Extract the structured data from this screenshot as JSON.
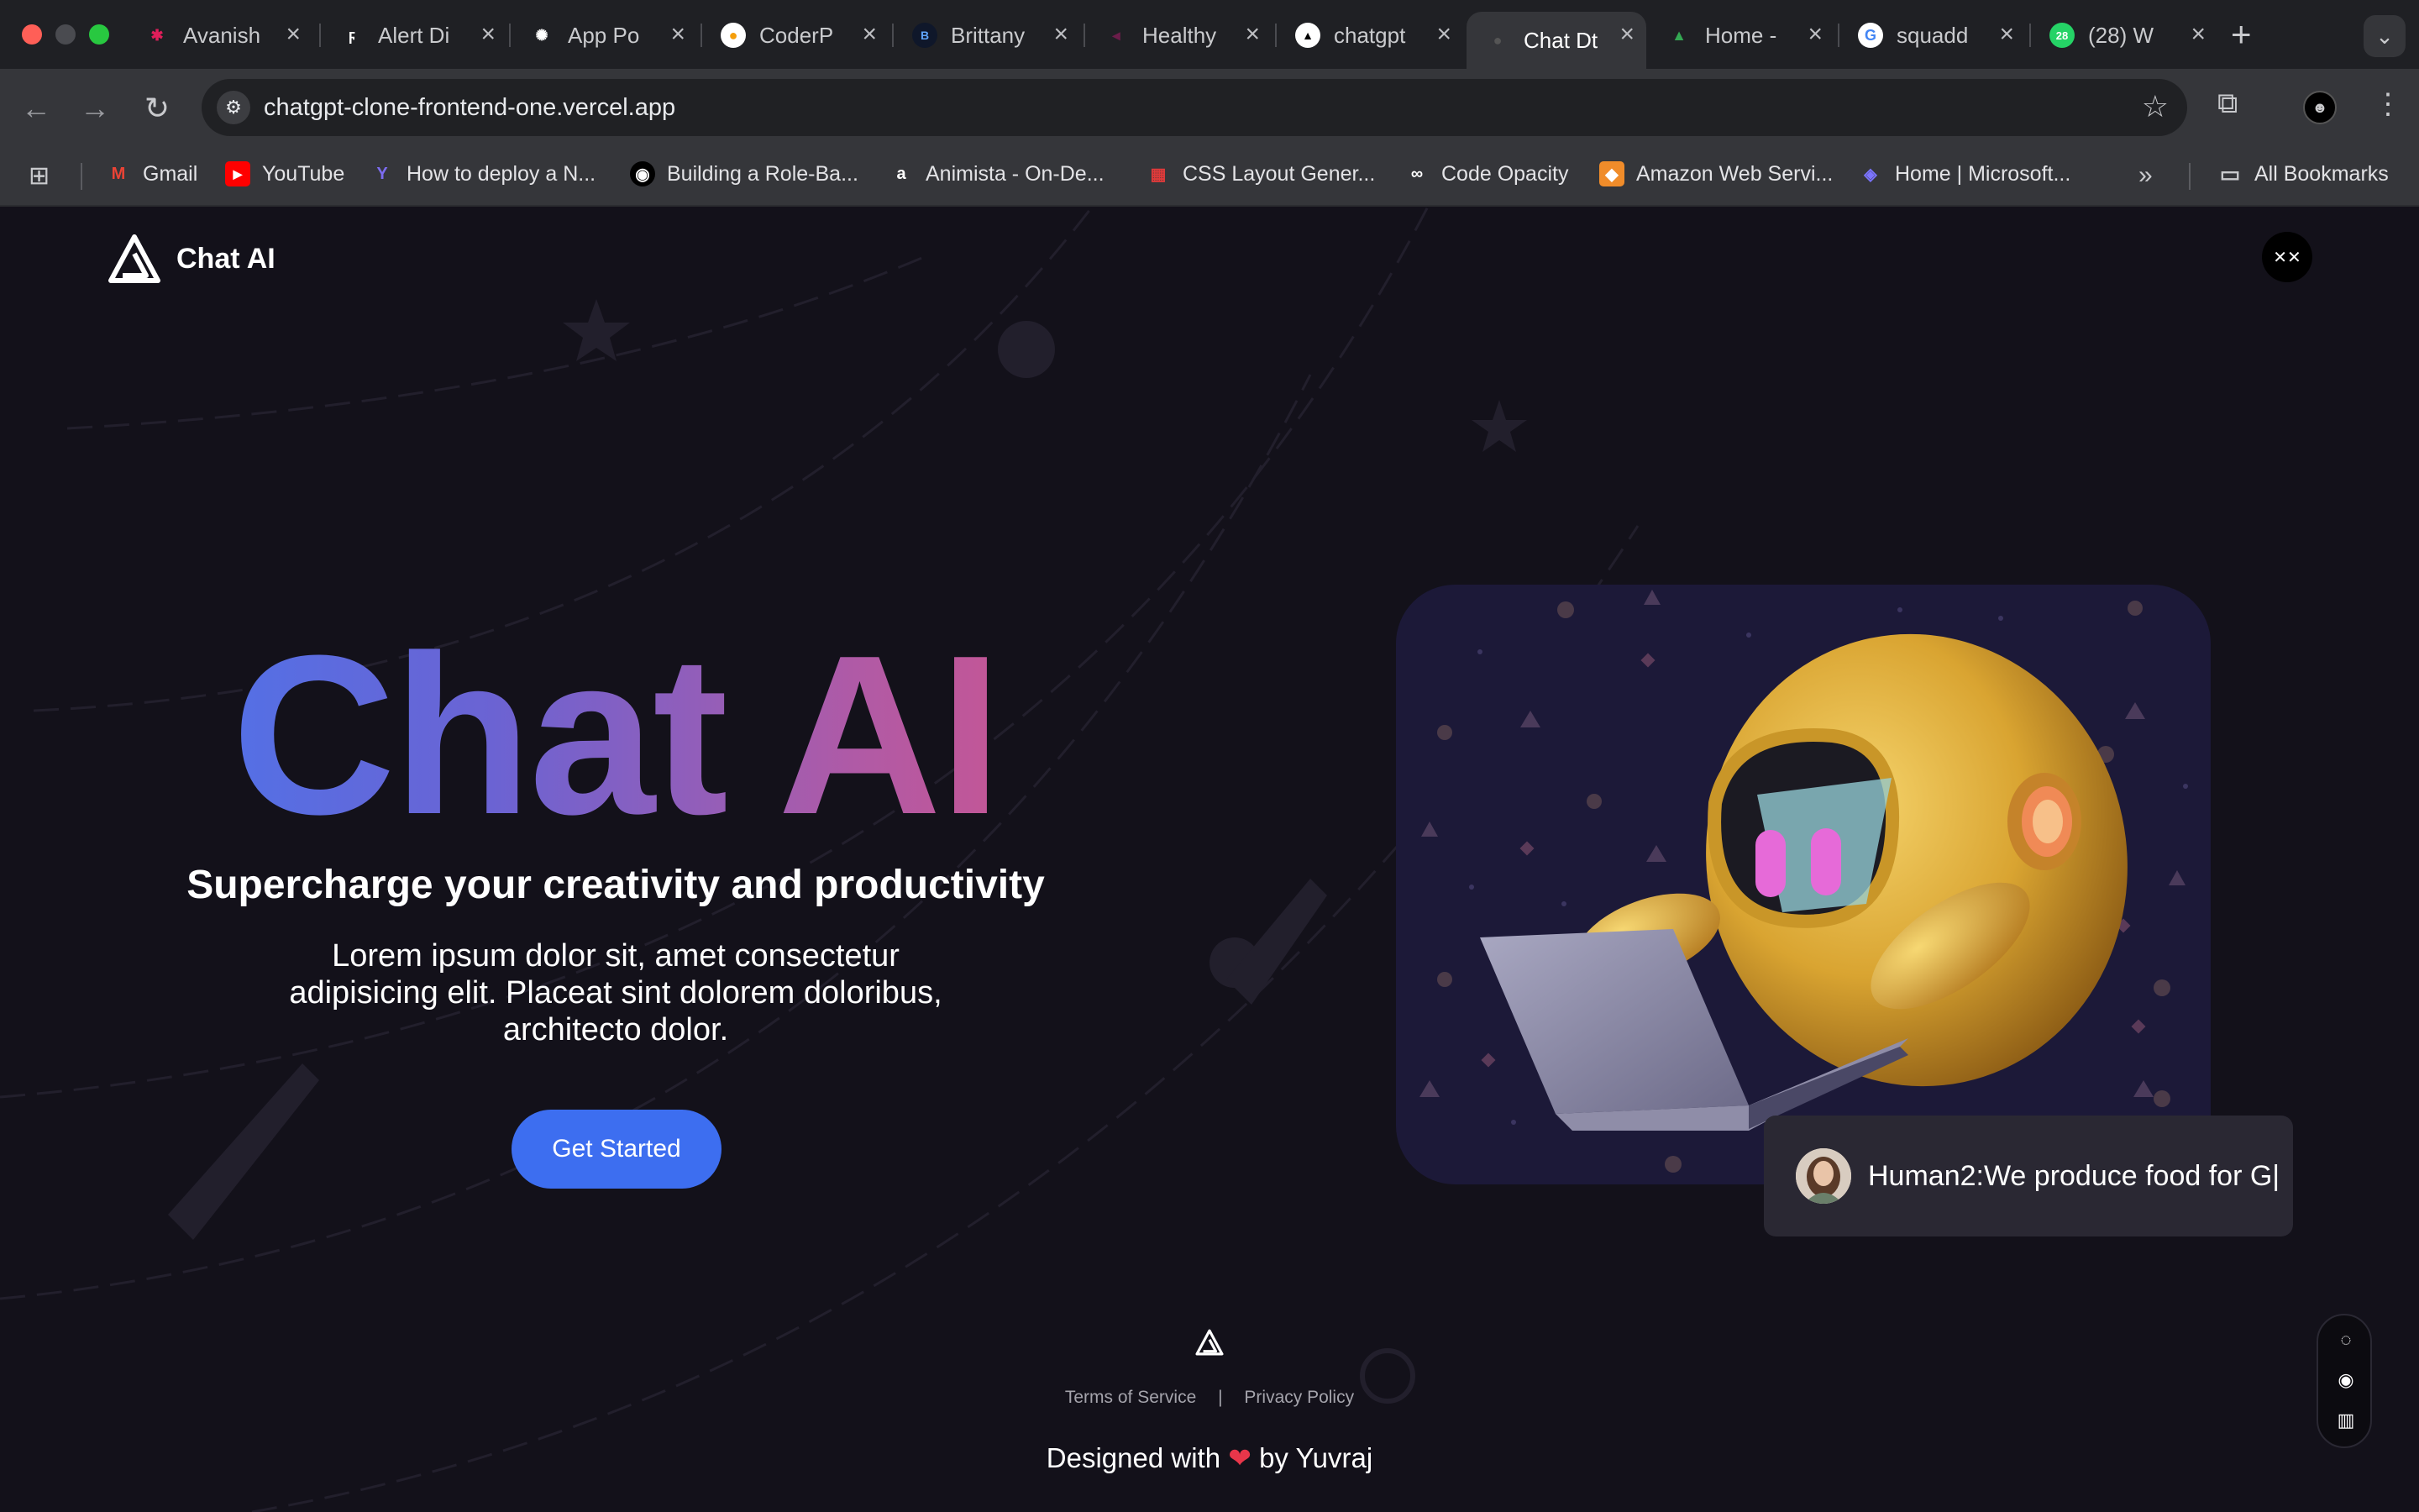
{
  "browser": {
    "tabs": [
      {
        "label": "Avanish",
        "icon": "slack-icon",
        "color": "#e01e5a"
      },
      {
        "label": "Alert Di",
        "icon": "framer-icon",
        "color": "#ffffff"
      },
      {
        "label": "App Po",
        "icon": "openai-icon",
        "color": "#ffffff"
      },
      {
        "label": "CoderP",
        "icon": "coder-icon",
        "color": "#f59e0b"
      },
      {
        "label": "Brittany",
        "icon": "b-icon",
        "color": "#1e3a8a"
      },
      {
        "label": "Healthy",
        "icon": "health-icon",
        "color": "#6b1d4a"
      },
      {
        "label": "chatgpt",
        "icon": "vercel-icon",
        "color": "#ffffff"
      },
      {
        "label": "Chat Dt",
        "icon": "page-icon",
        "color": "#555555"
      },
      {
        "label": "Home -",
        "icon": "google-drive-icon",
        "color": "#34a853"
      },
      {
        "label": "squadd",
        "icon": "google-icon",
        "color": "#4285f4"
      },
      {
        "label": "(28) W",
        "icon": "whatsapp-icon",
        "color": "#25d366"
      }
    ],
    "url": "chatgpt-clone-frontend-one.vercel.app",
    "bookmarks": [
      {
        "label": "Gmail",
        "icon": "gmail-icon"
      },
      {
        "label": "YouTube",
        "icon": "youtube-icon"
      },
      {
        "label": "How to deploy a N...",
        "icon": "deploy-icon"
      },
      {
        "label": "Building a Role-Ba...",
        "icon": "medium-icon"
      },
      {
        "label": "Animista - On-De...",
        "icon": "animista-icon"
      },
      {
        "label": "CSS Layout Gener...",
        "icon": "grid-icon"
      },
      {
        "label": "Code Opacity",
        "icon": "glasses-icon"
      },
      {
        "label": "Amazon Web Servi...",
        "icon": "aws-icon"
      },
      {
        "label": "Home | Microsoft...",
        "icon": "microsoft-icon"
      }
    ],
    "all_bookmarks": "All Bookmarks"
  },
  "page": {
    "brand": "Chat AI",
    "hero_title": "Chat AI",
    "hero_subtitle": "Supercharge your creativity and productivity",
    "hero_description": "Lorem ipsum dolor sit, amet consectetur adipisicing elit. Placeat sint dolorem doloribus, architecto dolor.",
    "cta_label": "Get Started",
    "chat_preview": "Human2:We produce food for G|",
    "footer": {
      "terms": "Terms of Service",
      "separator": "|",
      "privacy": "Privacy Policy",
      "credit_prefix": "Designed with",
      "credit_suffix": "by Yuvraj"
    }
  },
  "colors": {
    "accent": "#3d6ef0",
    "gradient_start": "#3f7bf5",
    "gradient_end": "#e0507e",
    "background": "#13111a"
  }
}
